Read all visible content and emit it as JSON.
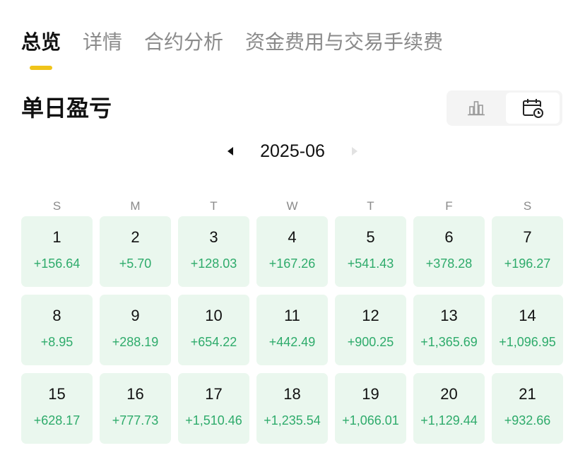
{
  "tabs": [
    {
      "label": "总览",
      "active": true
    },
    {
      "label": "详情",
      "active": false
    },
    {
      "label": "合约分析",
      "active": false
    },
    {
      "label": "资金费用与交易手续费",
      "active": false
    }
  ],
  "section_title": "单日盈亏",
  "view_toggle": {
    "options": [
      {
        "icon": "bar-chart-icon",
        "selected": false
      },
      {
        "icon": "calendar-icon",
        "selected": true
      }
    ]
  },
  "month_nav": {
    "month": "2025-06",
    "prev_icon": "triangle-left-icon",
    "next_icon": "triangle-right-icon"
  },
  "weekdays": [
    "S",
    "M",
    "T",
    "W",
    "T",
    "F",
    "S"
  ],
  "days": [
    {
      "day": "1",
      "pnl": "+156.64"
    },
    {
      "day": "2",
      "pnl": "+5.70"
    },
    {
      "day": "3",
      "pnl": "+128.03"
    },
    {
      "day": "4",
      "pnl": "+167.26"
    },
    {
      "day": "5",
      "pnl": "+541.43"
    },
    {
      "day": "6",
      "pnl": "+378.28"
    },
    {
      "day": "7",
      "pnl": "+196.27"
    },
    {
      "day": "8",
      "pnl": "+8.95"
    },
    {
      "day": "9",
      "pnl": "+288.19"
    },
    {
      "day": "10",
      "pnl": "+654.22"
    },
    {
      "day": "11",
      "pnl": "+442.49"
    },
    {
      "day": "12",
      "pnl": "+900.25"
    },
    {
      "day": "13",
      "pnl": "+1,365.69"
    },
    {
      "day": "14",
      "pnl": "+1,096.95"
    },
    {
      "day": "15",
      "pnl": "+628.17"
    },
    {
      "day": "16",
      "pnl": "+777.73"
    },
    {
      "day": "17",
      "pnl": "+1,510.46"
    },
    {
      "day": "18",
      "pnl": "+1,235.54"
    },
    {
      "day": "19",
      "pnl": "+1,066.01"
    },
    {
      "day": "20",
      "pnl": "+1,129.44"
    },
    {
      "day": "21",
      "pnl": "+932.66"
    }
  ],
  "colors": {
    "accent": "#f0c419",
    "profit_text": "#2eab6b",
    "cell_background": "#eaf7ee",
    "muted_text": "#8a8a8a"
  }
}
